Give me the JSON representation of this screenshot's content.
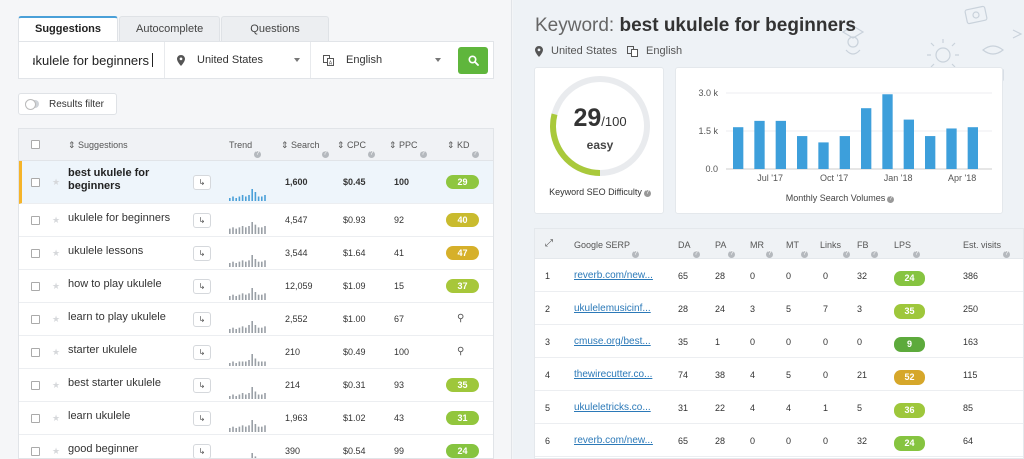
{
  "tabs": [
    {
      "label": "Suggestions",
      "active": true
    },
    {
      "label": "Autocomplete",
      "active": false
    },
    {
      "label": "Questions",
      "active": false
    }
  ],
  "search": {
    "keyword": "ukulele for beginners",
    "location": "United States",
    "language": "English"
  },
  "filter": {
    "label": "Results filter"
  },
  "columns": {
    "suggestions": "Suggestions",
    "trend": "Trend",
    "search": "Search",
    "cpc": "CPC",
    "ppc": "PPC",
    "kd": "KD"
  },
  "rows": [
    {
      "keyword": "best ukulele for beginners",
      "search": "1,600",
      "cpc": "$0.45",
      "ppc": "100",
      "kd": "29",
      "kd_color": "#8ec63f",
      "selected": true,
      "trend": [
        2,
        3,
        2,
        3,
        4,
        3,
        4,
        8,
        6,
        3,
        3,
        4
      ]
    },
    {
      "keyword": "ukulele for beginners",
      "search": "4,547",
      "cpc": "$0.93",
      "ppc": "92",
      "kd": "40",
      "kd_color": "#c9bb2e",
      "trend": [
        4,
        5,
        4,
        5,
        6,
        5,
        6,
        9,
        7,
        5,
        5,
        6
      ]
    },
    {
      "keyword": "ukulele lessons",
      "search": "3,544",
      "cpc": "$1.64",
      "ppc": "41",
      "kd": "47",
      "kd_color": "#d6b02a",
      "trend": [
        3,
        4,
        3,
        4,
        5,
        4,
        5,
        9,
        6,
        4,
        4,
        5
      ]
    },
    {
      "keyword": "how to play ukulele",
      "search": "12,059",
      "cpc": "$1.09",
      "ppc": "15",
      "kd": "37",
      "kd_color": "#a7c73a",
      "trend": [
        3,
        4,
        3,
        4,
        5,
        4,
        5,
        9,
        6,
        4,
        4,
        5
      ]
    },
    {
      "keyword": "learn to play ukulele",
      "search": "2,552",
      "cpc": "$1.00",
      "ppc": "67",
      "kd": "",
      "kd_color": "",
      "trend": [
        3,
        4,
        3,
        4,
        5,
        4,
        6,
        9,
        6,
        4,
        4,
        5
      ]
    },
    {
      "keyword": "starter ukulele",
      "search": "210",
      "cpc": "$0.49",
      "ppc": "100",
      "kd": "",
      "kd_color": "",
      "trend": [
        2,
        3,
        2,
        3,
        3,
        3,
        4,
        8,
        5,
        3,
        3,
        3
      ]
    },
    {
      "keyword": "best starter ukulele",
      "search": "214",
      "cpc": "$0.31",
      "ppc": "93",
      "kd": "35",
      "kd_color": "#9ec73b",
      "trend": [
        2,
        3,
        2,
        3,
        4,
        3,
        4,
        8,
        5,
        3,
        3,
        4
      ]
    },
    {
      "keyword": "learn ukulele",
      "search": "1,963",
      "cpc": "$1.02",
      "ppc": "43",
      "kd": "31",
      "kd_color": "#92c63d",
      "trend": [
        3,
        4,
        3,
        4,
        5,
        4,
        5,
        9,
        6,
        4,
        4,
        5
      ]
    },
    {
      "keyword": "good beginner",
      "search": "390",
      "cpc": "$0.54",
      "ppc": "99",
      "kd": "24",
      "kd_color": "#86c440",
      "trend": [
        2,
        3,
        2,
        3,
        3,
        3,
        4,
        7,
        5,
        3,
        3,
        3
      ]
    }
  ],
  "keyword_panel": {
    "prefix": "Keyword:",
    "keyword": "best ukulele for beginners",
    "location": "United States",
    "language": "English"
  },
  "difficulty": {
    "value": "29",
    "max": "/100",
    "label": "easy",
    "caption": "Keyword SEO Difficulty",
    "fraction": 0.29,
    "color": "#a9c93b"
  },
  "chart_data": {
    "type": "bar",
    "title": "Monthly Search Volumes",
    "yticks": [
      "3.0 k",
      "1.5 k",
      "0.0"
    ],
    "ylim": [
      0,
      3000
    ],
    "xticks": [
      "Jul '17",
      "Oct '17",
      "Jan '18",
      "Apr '18"
    ],
    "xtick_index": [
      2,
      5,
      8,
      11
    ],
    "values": [
      1650,
      1900,
      1900,
      1300,
      1050,
      1300,
      2400,
      2950,
      1950,
      1300,
      1600,
      1650
    ],
    "color": "#3d9fdb"
  },
  "serp": {
    "columns": {
      "serp": "Google SERP",
      "da": "DA",
      "pa": "PA",
      "mr": "MR",
      "mt": "MT",
      "links": "Links",
      "fb": "FB",
      "lps": "LPS",
      "visits": "Est. visits"
    },
    "rows": [
      {
        "rank": "1",
        "url": "reverb.com/new...",
        "da": "65",
        "pa": "28",
        "mr": "0",
        "mt": "0",
        "links": "0",
        "fb": "32",
        "lps": "24",
        "lps_color": "#86c440",
        "visits": "386"
      },
      {
        "rank": "2",
        "url": "ukulelemusicinf...",
        "da": "28",
        "pa": "24",
        "mr": "3",
        "mt": "5",
        "links": "7",
        "fb": "3",
        "lps": "35",
        "lps_color": "#9ec73b",
        "visits": "250"
      },
      {
        "rank": "3",
        "url": "cmuse.org/best...",
        "da": "35",
        "pa": "1",
        "mr": "0",
        "mt": "0",
        "links": "0",
        "fb": "0",
        "lps": "9",
        "lps_color": "#5daa3c",
        "visits": "163"
      },
      {
        "rank": "4",
        "url": "thewirecutter.co...",
        "da": "74",
        "pa": "38",
        "mr": "4",
        "mt": "5",
        "links": "0",
        "fb": "21",
        "lps": "52",
        "lps_color": "#d6a72a",
        "visits": "115"
      },
      {
        "rank": "5",
        "url": "ukuleletricks.co...",
        "da": "31",
        "pa": "22",
        "mr": "4",
        "mt": "4",
        "links": "1",
        "fb": "5",
        "lps": "36",
        "lps_color": "#9ec73b",
        "visits": "85"
      },
      {
        "rank": "6",
        "url": "reverb.com/new...",
        "da": "65",
        "pa": "28",
        "mr": "0",
        "mt": "0",
        "links": "0",
        "fb": "32",
        "lps": "24",
        "lps_color": "#86c440",
        "visits": "64"
      }
    ]
  },
  "icons": {
    "location": "map-pin-icon",
    "language": "translate-icon",
    "search": "search-icon",
    "help": "help-icon",
    "expand": "expand-icon"
  }
}
